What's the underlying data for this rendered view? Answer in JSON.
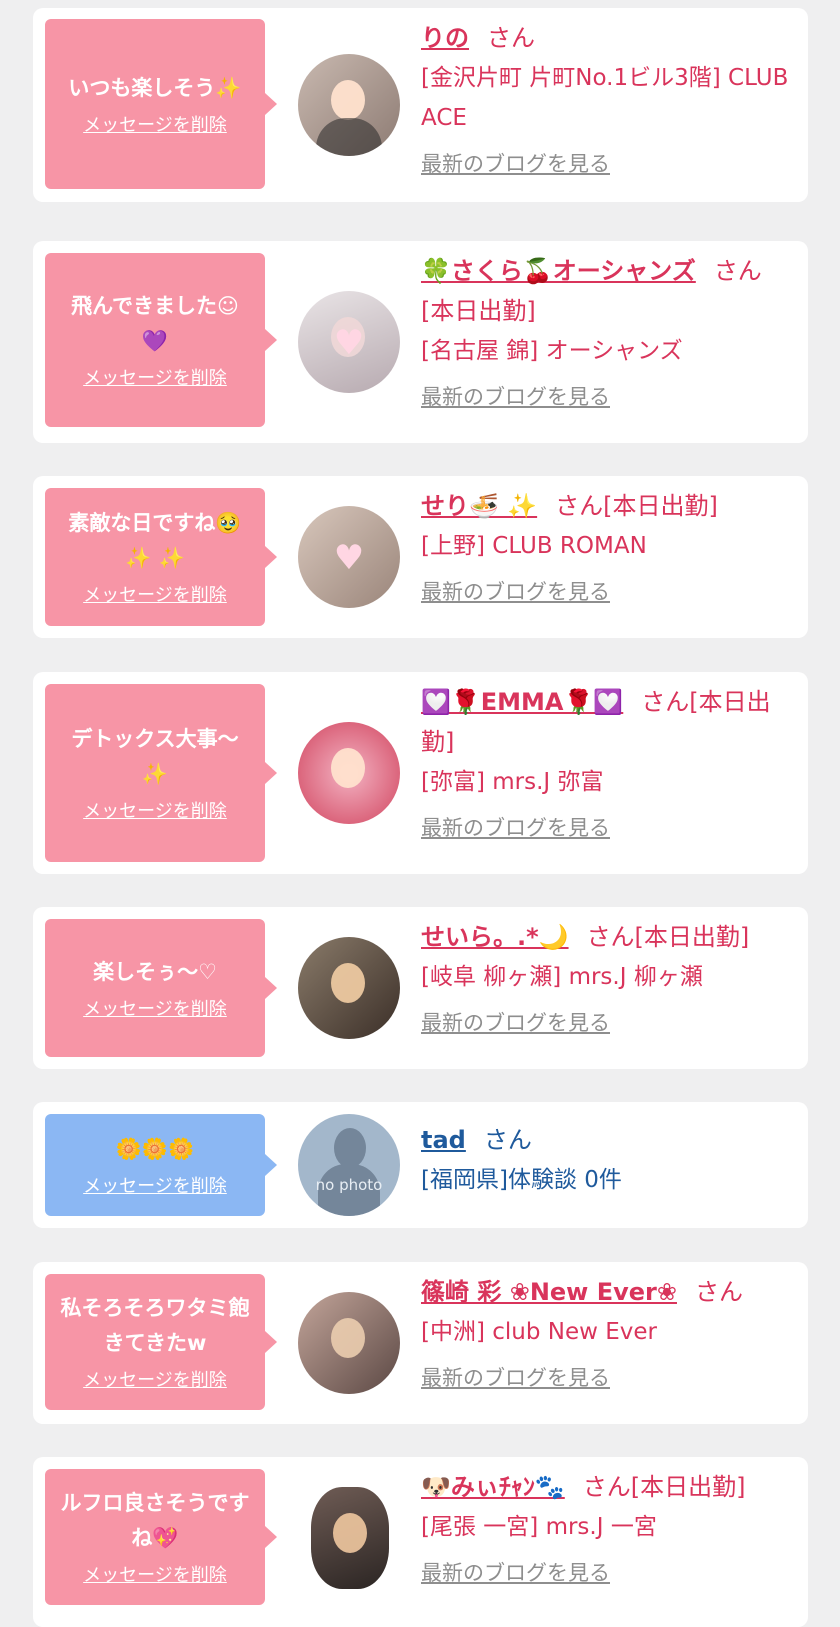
{
  "delete_label": "メッセージを削除",
  "blog_label": "最新のブログを見る",
  "cards": [
    {
      "message": "いつも楽しそう✨",
      "name": "りの",
      "suffix": "さん",
      "shop": "[金沢片町 片町No.1ビル3階] CLUB ACE",
      "has_blog": true
    },
    {
      "message": "飛んできました☺\n💜",
      "name": "🍀さくら🍒オーシャンズ",
      "suffix": "さん[本日出勤]",
      "shop": "[名古屋 錦] オーシャンズ",
      "has_blog": true
    },
    {
      "message": "素敵な日ですね🥹\n✨ ✨",
      "name": "せり🍜 ✨",
      "suffix": "さん[本日出勤]",
      "shop": "[上野] CLUB ROMAN",
      "has_blog": true
    },
    {
      "message": "デトックス大事〜\n✨",
      "name": "💟🌹EMMA🌹💟",
      "suffix": "さん[本日出勤]",
      "shop": "[弥富] mrs.J 弥富",
      "has_blog": true
    },
    {
      "message": "楽しそぅ〜♡",
      "name": "せいら。.*🌙",
      "suffix": "さん[本日出勤]",
      "shop": "[岐阜 柳ヶ瀬] mrs.J 柳ヶ瀬",
      "has_blog": true
    },
    {
      "message": "🌼🌼🌼",
      "name": "tad",
      "suffix": "さん",
      "shop": "[福岡県]体験談 0件",
      "has_blog": false,
      "avatar_text": "no photo"
    },
    {
      "message": "私そろそろワタミ飽きてきたw",
      "name": "篠崎 彩 ❀New Ever❀",
      "suffix": "さん",
      "shop": "[中洲] club New Ever",
      "has_blog": true
    },
    {
      "message": "ルフロ良さそうですね💖",
      "name": "🐶みぃﾁｬﾝ🐾",
      "suffix": "さん[本日出勤]",
      "shop": "[尾張 一宮] mrs.J 一宮",
      "has_blog": true
    }
  ],
  "colors": {
    "bubble_pink": "#f795a6",
    "bubble_blue": "#8bb7f3",
    "name_pink": "#d9345b",
    "name_blue": "#1f5a9c",
    "link_gray": "#8e8e8e",
    "background": "#efeff0"
  },
  "icons": [
    "avatar-photo",
    "no-photo-avatar",
    "heart-sticker-icon",
    "bubble-arrow"
  ]
}
